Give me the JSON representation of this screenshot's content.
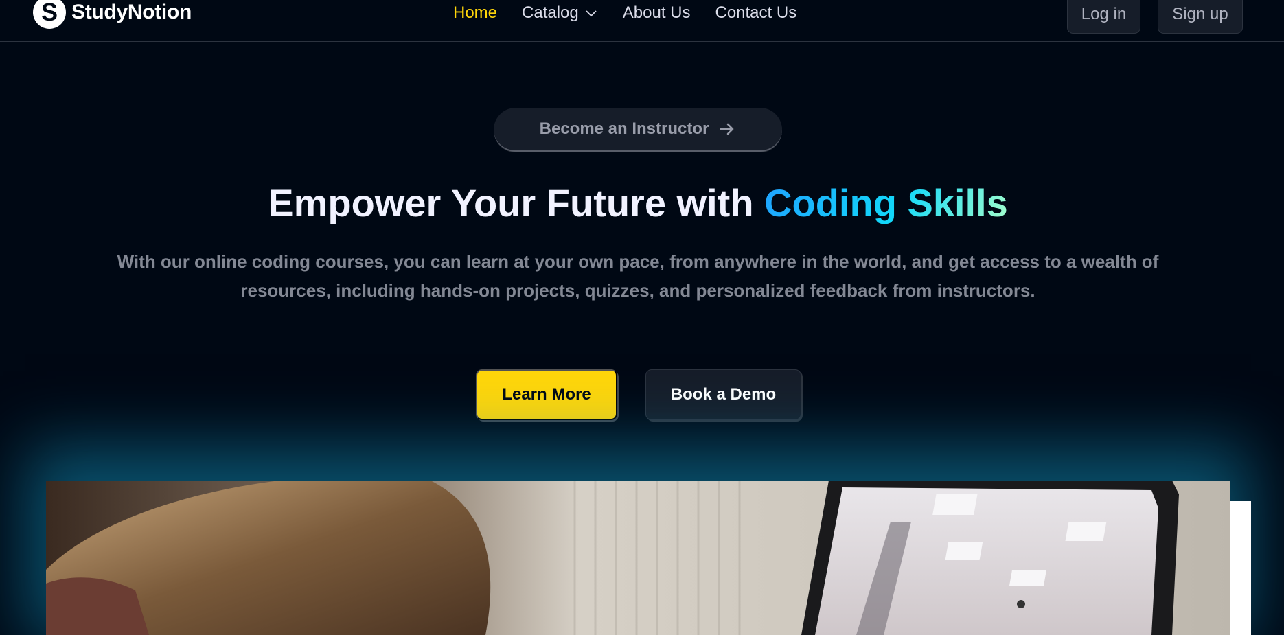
{
  "brand": {
    "logo_letter": "S",
    "name": "StudyNotion"
  },
  "nav": {
    "links": [
      {
        "label": "Home",
        "active": true
      },
      {
        "label": "Catalog",
        "has_dropdown": true
      },
      {
        "label": "About Us"
      },
      {
        "label": "Contact Us"
      }
    ],
    "login_label": "Log in",
    "signup_label": "Sign up"
  },
  "hero": {
    "instructor_label": "Become an Instructor",
    "title_plain": "Empower Your Future with ",
    "title_highlight": "Coding Skills",
    "subtitle": "With our online coding courses, you can learn at your own pace, from anywhere in the world, and get access to a wealth of resources, including hands-on projects, quizzes, and personalized feedback from instructors.",
    "learn_more_label": "Learn More",
    "demo_label": "Book a Demo"
  },
  "colors": {
    "background": "#000814",
    "accent_yellow": "#ffd60a",
    "gradient_start": "#1fa2ff",
    "gradient_mid": "#12d8fa",
    "gradient_end": "#a6ffcb",
    "glow": "#118ab2"
  },
  "icons": {
    "catalog_dropdown": "chevron-down-icon",
    "instructor_arrow": "arrow-right-icon"
  }
}
